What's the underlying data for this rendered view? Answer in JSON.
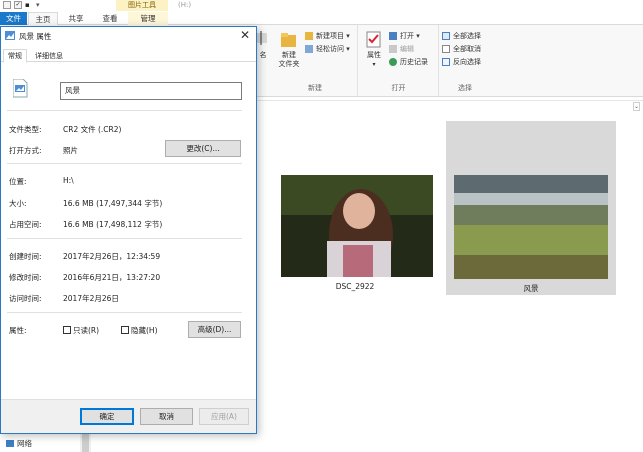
{
  "titlebar": {
    "context_tab": "图片工具",
    "drive": "(H:)"
  },
  "ribbon_tabs": {
    "file": "文件",
    "home": "主页",
    "share": "共享",
    "view": "查看",
    "manage": "管理"
  },
  "ribbon": {
    "partial_label": "名",
    "new_group": {
      "new_folder": "新建\n文件夹",
      "new_item": "新建项目",
      "easy_access": "轻松访问",
      "label": "新建"
    },
    "open_group": {
      "properties": "属性",
      "open": "打开",
      "edit": "编辑",
      "history": "历史记录",
      "label": "打开"
    },
    "select_group": {
      "select_all": "全部选择",
      "select_none": "全部取消",
      "invert": "反向选择",
      "label": "选择"
    }
  },
  "files": [
    {
      "caption": "DSC_2922"
    },
    {
      "caption": "风景"
    }
  ],
  "nav": {
    "network": "网络"
  },
  "dialog": {
    "title": "风景 属性",
    "tabs": [
      "常规",
      "详细信息"
    ],
    "file_name": "风景",
    "type_label": "文件类型:",
    "type_value": "CR2 文件 (.CR2)",
    "opens_label": "打开方式:",
    "opens_value": "照片",
    "change_button": "更改(C)...",
    "location_label": "位置:",
    "location_value": "H:\\",
    "size_label": "大小:",
    "size_value": "16.6 MB (17,497,344 字节)",
    "disk_label": "占用空间:",
    "disk_value": "16.6 MB (17,498,112 字节)",
    "created_label": "创建时间:",
    "created_value": "2017年2月26日，12:34:59",
    "modified_label": "修改时间:",
    "modified_value": "2016年6月21日，13:27:20",
    "accessed_label": "访问时间:",
    "accessed_value": "2017年2月26日",
    "attr_label": "属性:",
    "readonly_label": "只读(R)",
    "hidden_label": "隐藏(H)",
    "advanced_button": "高级(D)...",
    "ok_button": "确定",
    "cancel_button": "取消",
    "apply_button": "应用(A)"
  }
}
